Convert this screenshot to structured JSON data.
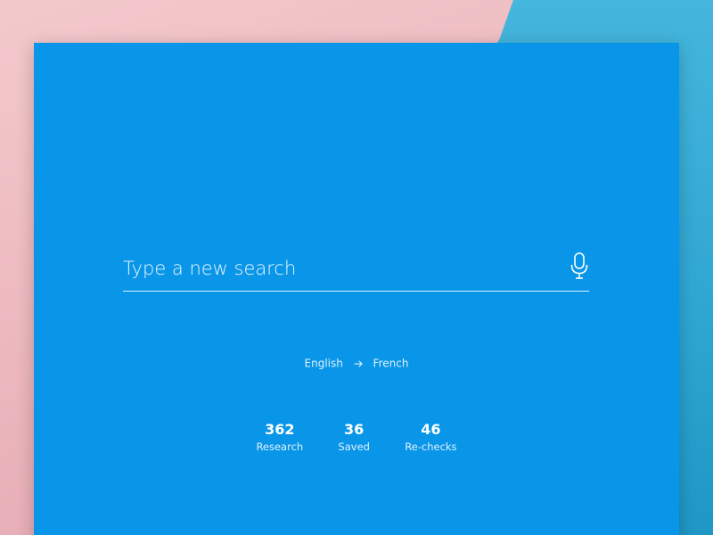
{
  "search": {
    "placeholder": "Type a new search",
    "mic_icon": "microphone-icon"
  },
  "language": {
    "from": "English",
    "to": "French",
    "arrow_icon": "arrow-right-icon"
  },
  "stats": [
    {
      "value": "362",
      "label": "Research"
    },
    {
      "value": "36",
      "label": "Saved"
    },
    {
      "value": "46",
      "label": "Re-checks"
    }
  ],
  "colors": {
    "card": "#0996e8",
    "background_pink": "#f2c5c8",
    "background_teal": "#2ea6d2",
    "text": "#ffffff"
  }
}
